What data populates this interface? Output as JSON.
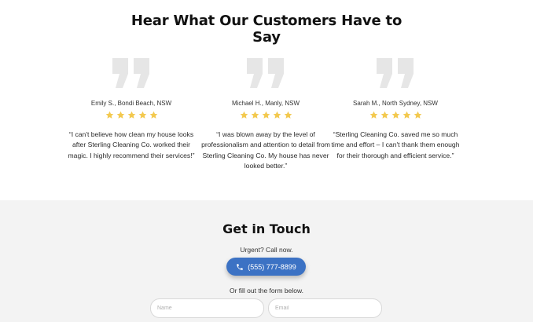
{
  "testimonials": {
    "title_line1": "Hear What Our Customers Have to",
    "title_line2": "Say",
    "rating_color": "#f3c94f",
    "quote_icon": "quote-icon",
    "cards": [
      {
        "reviewer": "Emily S., Bondi Beach, NSW",
        "stars": 5,
        "text": "“I can't believe how clean my house looks after Sterling Cleaning Co. worked their magic. I highly recommend their services!”"
      },
      {
        "reviewer": "Michael H., Manly, NSW",
        "stars": 5,
        "text": "“I was blown away by the level of professionalism and attention to detail from Sterling Cleaning Co. My house has never looked better.”"
      },
      {
        "reviewer": "Sarah M., North Sydney, NSW",
        "stars": 5,
        "text": "“Sterling Cleaning Co. saved me so much time and effort – I can't thank them enough for their thorough and efficient service.”"
      }
    ]
  },
  "contact": {
    "title": "Get in Touch",
    "urgent_text": "Urgent? Call now.",
    "phone_label": "(555) 777-8899",
    "phone_icon": "phone-icon",
    "button_color": "#3c72c4",
    "form_intro": "Or fill out the form below.",
    "name_placeholder": "Name",
    "email_placeholder": "Email"
  }
}
